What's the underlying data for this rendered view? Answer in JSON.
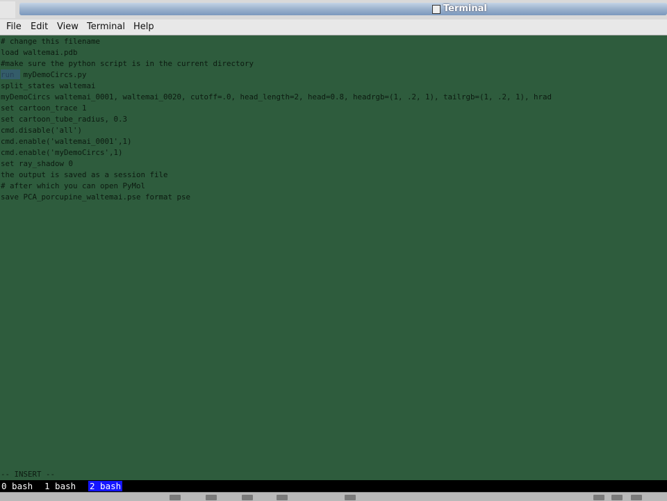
{
  "window": {
    "title": "Terminal"
  },
  "menu": {
    "items": [
      "File",
      "Edit",
      "View",
      "Terminal",
      "Help"
    ]
  },
  "terminal": {
    "lines": [
      "# change this filename",
      "load waltemai.pdb",
      "#make sure the python script is in the current directory",
      "run  myDemoCircs.py",
      "split_states waltemai",
      "myDemoCircs waltemai_0001, waltemai_0020, cutoff=.0, head_length=2, head=0.8, headrgb=(1, .2, 1), tailrgb=(1, .2, 1), hrad",
      "set cartoon_trace 1",
      "set cartoon_tube_radius, 0.3",
      "cmd.disable('all')",
      "cmd.enable('waltemai_0001',1)",
      "cmd.enable('myDemoCircs',1)",
      "set ray_shadow 0",
      "the output is saved as a session file",
      "# after which you can open PyMol",
      "save PCA_porcupine_waltemai.pse format pse"
    ],
    "mode": "-- INSERT --"
  },
  "tabs": [
    "0 bash",
    "1 bash",
    "2 bash"
  ],
  "active_tab": 2,
  "colors": {
    "terminal_bg": "#2e5c3d",
    "text": "#0c1a10",
    "active_tab": "#1515ff"
  }
}
